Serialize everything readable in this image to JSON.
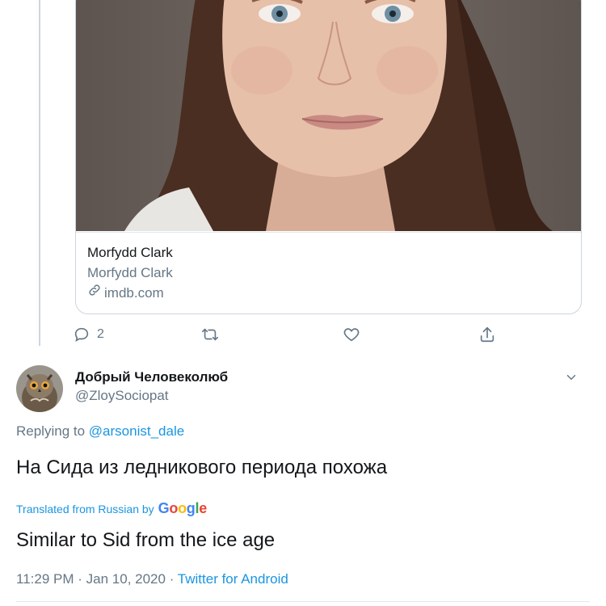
{
  "link_card": {
    "title": "Morfydd Clark",
    "description": "Morfydd Clark",
    "domain": "imdb.com",
    "image_alt": "portrait photo"
  },
  "parent_actions": {
    "reply_count": "2",
    "retweet_count": "",
    "like_count": ""
  },
  "tweet": {
    "display_name": "Добрый Человеколюб",
    "handle": "@ZloySociopat",
    "replying_prefix": "Replying to",
    "replying_mention": "@arsonist_dale",
    "text": "На Сида из ледникового периода похожа",
    "translated_label": "Translated from Russian by",
    "translator": "Google",
    "translation": "Similar to Sid from the ice age",
    "time": "11:29 PM",
    "separator": "·",
    "date": "Jan 10, 2020",
    "source": "Twitter for Android"
  },
  "colors": {
    "accent": "#1b95e0",
    "secondary_text": "#657786",
    "primary_text": "#14171a",
    "border": "#ccd6dd"
  }
}
